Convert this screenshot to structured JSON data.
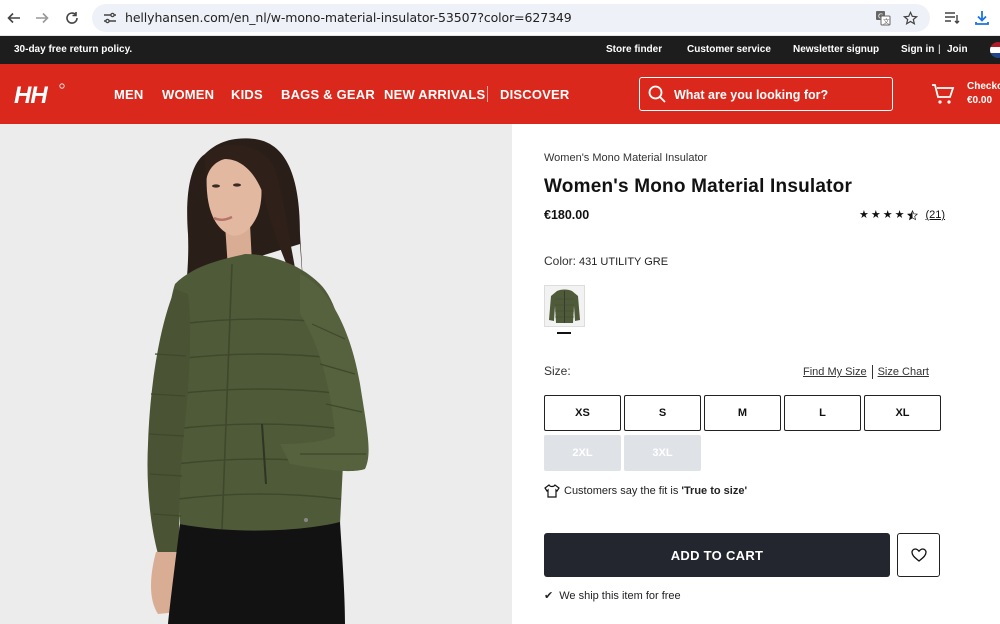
{
  "browser": {
    "url": "hellyhansen.com/en_nl/w-mono-material-insulator-53507?color=627349"
  },
  "util_bar": {
    "promo": "30-day free return policy.",
    "links": [
      "Store finder",
      "Customer service",
      "Newsletter signup",
      "Sign in",
      "|",
      "Join"
    ]
  },
  "header": {
    "logo": "HH",
    "nav": [
      "MEN",
      "WOMEN",
      "KIDS",
      "BAGS & GEAR",
      "NEW ARRIVALS",
      "DISCOVER"
    ],
    "search_placeholder": "What are you looking for?",
    "cart_label": "Checko",
    "cart_total": "€0.00"
  },
  "product": {
    "name_small": "Women's Mono Material Insulator",
    "title": "Women's Mono Material Insulator",
    "price": "€180.00",
    "rating": 4.5,
    "rating_count": "(21)",
    "color_label": "Color:",
    "color_value": "431 UTILITY GRE",
    "size_label": "Size:",
    "find_my_size": "Find My Size",
    "size_chart": "Size Chart",
    "sizes": [
      {
        "label": "XS",
        "available": true
      },
      {
        "label": "S",
        "available": true
      },
      {
        "label": "M",
        "available": true
      },
      {
        "label": "L",
        "available": true
      },
      {
        "label": "XL",
        "available": true
      },
      {
        "label": "2XL",
        "available": false
      },
      {
        "label": "3XL",
        "available": false
      }
    ],
    "fit_text": "Customers say the fit is",
    "fit_value": "'True to size'",
    "add_to_cart": "ADD TO CART",
    "ship_note": "We ship this item for free"
  },
  "icons": {
    "back": "arrow-left-icon",
    "forward": "arrow-right-icon",
    "reload": "reload-icon",
    "site_settings": "tune-icon",
    "translate": "translate-icon",
    "bookmark": "star-icon",
    "reading_list": "list-icon",
    "download": "download-icon",
    "search": "search-icon",
    "cart": "cart-icon",
    "wishlist": "heart-icon",
    "fit": "tshirt-icon",
    "ship": "check-icon"
  },
  "colors": {
    "brand_red": "#da291c",
    "util_bar": "#1d1d1d",
    "add_to_cart_bg": "#23252f",
    "jacket_green": "#4f5a38"
  }
}
